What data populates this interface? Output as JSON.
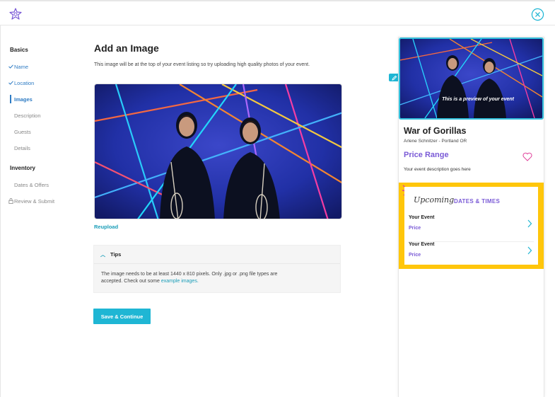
{
  "topbar": {
    "logo_icon": "flower-logo-icon",
    "close_icon": "close-circle-icon"
  },
  "sidebar": {
    "groups": [
      "Basics",
      "Inventory"
    ],
    "items": [
      {
        "label": "Name",
        "state": "done",
        "icon": "check-icon"
      },
      {
        "label": "Location",
        "state": "done",
        "icon": "check-icon"
      },
      {
        "label": "Images",
        "state": "active",
        "icon": ""
      },
      {
        "label": "Description",
        "state": "pending",
        "icon": ""
      },
      {
        "label": "Guests",
        "state": "pending",
        "icon": ""
      },
      {
        "label": "Details",
        "state": "pending",
        "icon": ""
      },
      {
        "label": "Dates & Offers",
        "state": "pending",
        "icon": ""
      },
      {
        "label": "Review & Submit",
        "state": "locked",
        "icon": "lock-icon"
      }
    ]
  },
  "main": {
    "title": "Add an Image",
    "description": "This image will be at the top of your event listing so try uploading high quality photos of your event.",
    "reupload_label": "Reupload",
    "tips": {
      "heading": "Tips",
      "body": "The image needs to be at least 1440 x 810 pixels. Only .jpg or .png file types are accepted. Check out some",
      "body_line2": "accepted. Check out some",
      "link_text": "example images.",
      "line1": "The image needs to be at least 1440 x 810 pixels. Only .jpg or .png file types are"
    },
    "save_label": "Save & Continue"
  },
  "preview": {
    "caption": "This is a preview of your event",
    "event_title": "War of Gorillas",
    "venue": "Arlene Schnitzer - Portland OR",
    "price_range": "Price Range",
    "description": "Your event description goes here",
    "dates": {
      "upcoming": "Upcoming",
      "label": "DATES & TIMES",
      "rows": [
        {
          "event": "Your Event",
          "price": "Price"
        },
        {
          "event": "Your Event",
          "price": "Price"
        }
      ]
    }
  },
  "colors": {
    "accent": "#1fb6d4",
    "link": "#2f7cc4",
    "purple": "#7a5ad6",
    "yellow": "#ffc60b"
  }
}
